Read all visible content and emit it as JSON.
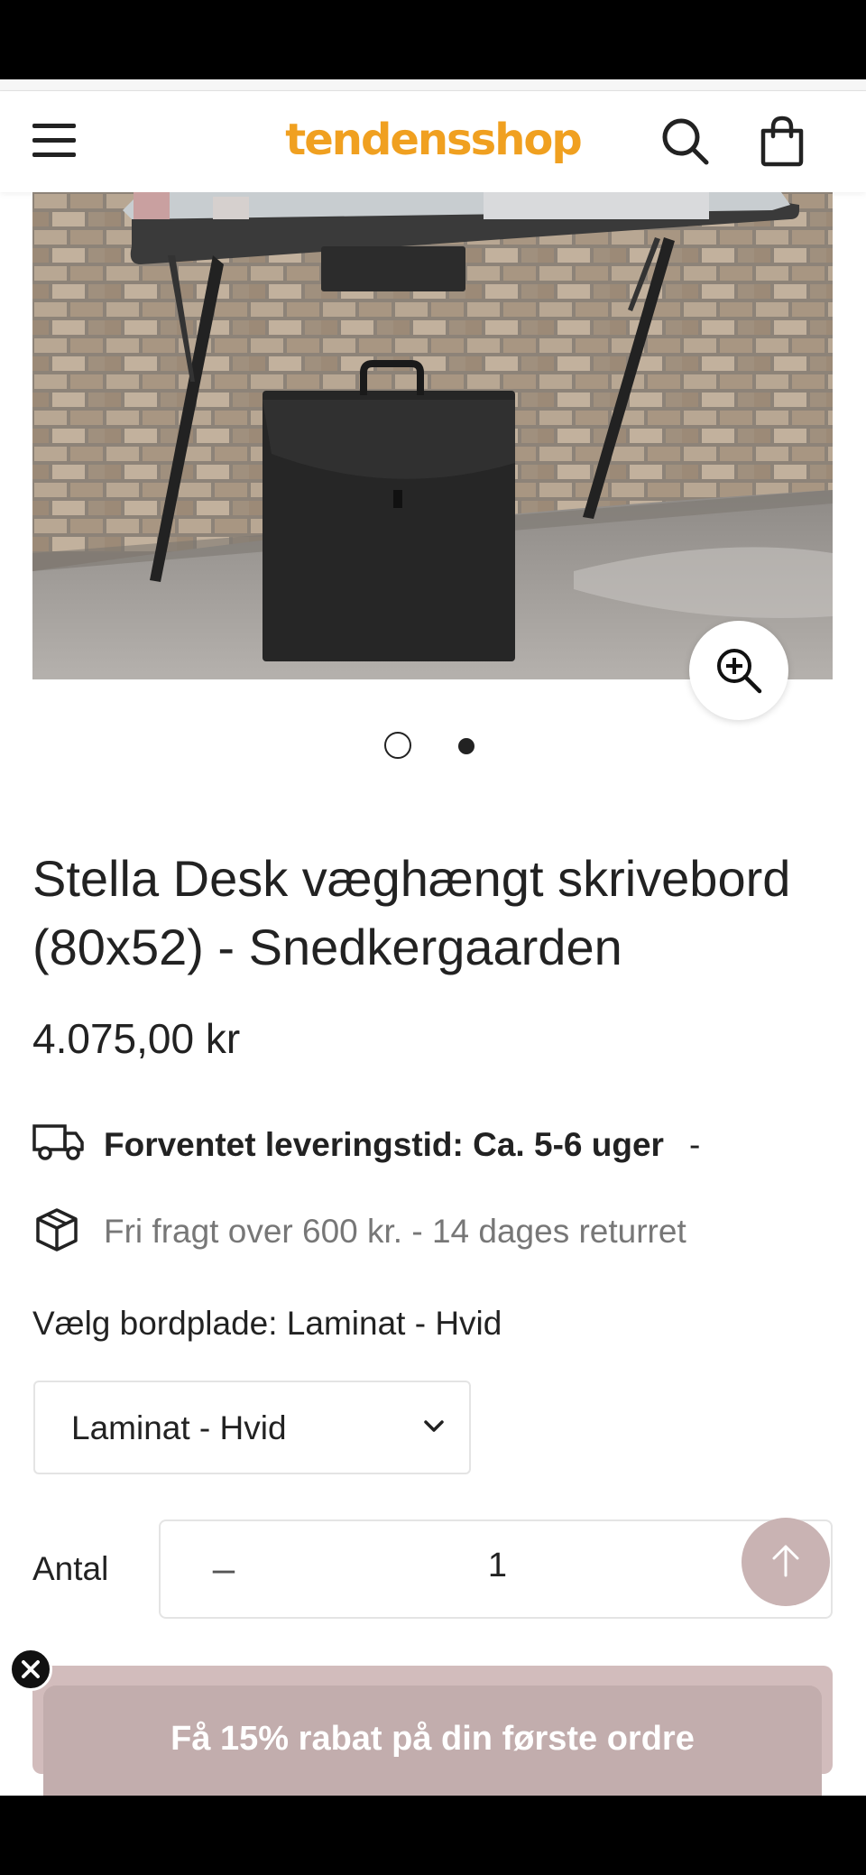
{
  "header": {
    "logo": "tendensshop",
    "menu_icon": "hamburger-menu-icon",
    "search_icon": "search-icon",
    "cart_icon": "shopping-bag-icon"
  },
  "gallery": {
    "image_description_icon": "product-photo",
    "zoom_icon": "zoom-in-icon",
    "slides_count": 2,
    "active_slide": 2
  },
  "product": {
    "title": "Stella Desk væghængt skrivebord (80x52) - Snedkergaarden",
    "price": "4.075,00 kr",
    "delivery_text": "Forventet leveringstid: Ca. 5-6 uger",
    "delivery_suffix": "-",
    "shipping_text": "Fri fragt over 600 kr. - 14 dages returret",
    "variant_label": "Vælg bordplade: Laminat - Hvid",
    "variant_selected": "Laminat - Hvid",
    "quantity_label": "Antal",
    "quantity_minus": "–",
    "quantity_value": "1"
  },
  "promo": {
    "text": "Få 15% rabat på din første ordre"
  },
  "colors": {
    "brand": "#f0a020",
    "promo_bg": "#c2adad",
    "scroll_top_bg": "#c9b3b3"
  }
}
